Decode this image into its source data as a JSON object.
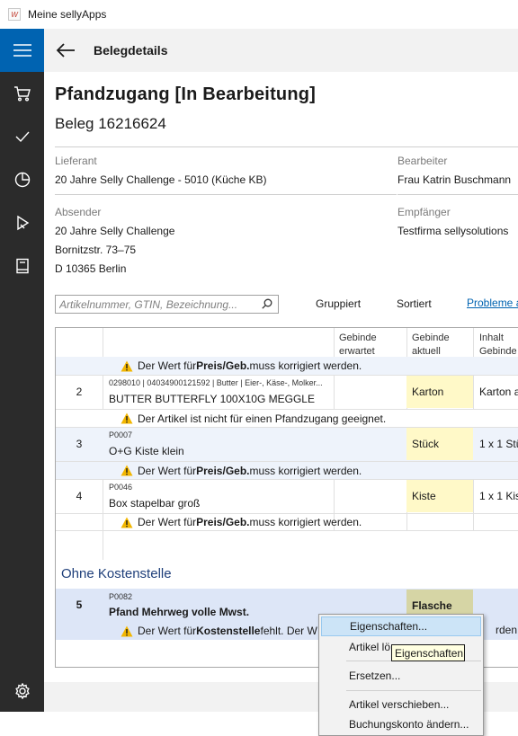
{
  "window": {
    "title": "Meine sellyApps"
  },
  "header": {
    "title": "Belegdetails"
  },
  "document": {
    "title": "Pfandzugang [In Bearbeitung]",
    "number": "Beleg 16216624"
  },
  "info": {
    "lieferant_label": "Lieferant",
    "lieferant_value": "20 Jahre Selly Challenge - 5010 (Küche KB)",
    "bearbeiter_label": "Bearbeiter",
    "bearbeiter_value": "Frau Katrin Buschmann",
    "absender_label": "Absender",
    "absender_lines": [
      "20 Jahre Selly Challenge",
      "Bornitzstr. 73–75",
      "D 10365 Berlin"
    ],
    "empfaenger_label": "Empfänger",
    "empfaenger_value": "Testfirma sellysolutions"
  },
  "toolbar": {
    "search_placeholder": "Artikelnummer, GTIN, Bezeichnung...",
    "group_label": "Gruppiert",
    "sort_label": "Sortiert",
    "problems_link": "Probleme a"
  },
  "table": {
    "headers": {
      "gebinde_erwartet": [
        "Gebinde",
        "erwartet"
      ],
      "gebinde_aktuell": [
        "Gebinde",
        "aktuell"
      ],
      "inhalt_gebinde": [
        "Inhalt",
        "Gebinde"
      ]
    },
    "top_warning": {
      "pre": "Der Wert für ",
      "bold": "Preis/Geb.",
      "post": " muss korrigiert werden."
    },
    "rows": [
      {
        "num": "2",
        "code": "0298010 | 04034900121592 | Butter | Eier-, Käse-, Molker...",
        "name": "BUTTER BUTTERFLY 100X10G MEGGLE",
        "gebinde": "Karton",
        "inhalt": "Karton a",
        "warning": {
          "pre": "Der Artikel ist nicht für einen Pfandzugang geeignet.",
          "bold": "",
          "post": ""
        }
      },
      {
        "num": "3",
        "code": "P0007",
        "name": "O+G Kiste klein",
        "gebinde": "Stück",
        "inhalt": "1 x 1 Stü",
        "warning": {
          "pre": "Der Wert für ",
          "bold": "Preis/Geb.",
          "post": " muss korrigiert werden."
        }
      },
      {
        "num": "4",
        "code": "P0046",
        "name": "Box stapelbar groß",
        "gebinde": "Kiste",
        "inhalt": "1 x 1 Kis",
        "warning": {
          "pre": "Der Wert für ",
          "bold": "Preis/Geb.",
          "post": " muss korrigiert werden."
        }
      }
    ],
    "section_title": "Ohne Kostenstelle",
    "selected_row": {
      "num": "5",
      "code": "P0082",
      "name": "Pfand Mehrweg volle Mwst.",
      "gebinde": "Flasche",
      "warning_pre": "Der Wert für ",
      "warning_bold": "Kostenstelle",
      "warning_post": " fehlt. Der W",
      "warning_tail": "rden."
    }
  },
  "context_menu": {
    "items": [
      "Eigenschaften...",
      "Artikel lö",
      "Ersetzen...",
      "Artikel verschieben...",
      "Buchungskonto ändern..."
    ],
    "tooltip": "Eigenschaften"
  },
  "colors": {
    "accent": "#0063b1",
    "rail": "#2b2b2b",
    "highlight_cell": "#fff9c8",
    "selected_row": "#dde6f7",
    "warning": "#f2b600"
  }
}
